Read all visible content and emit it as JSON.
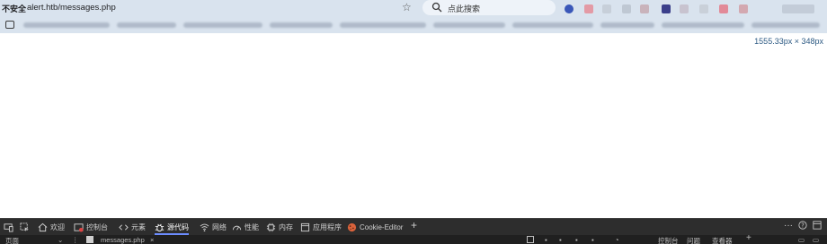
{
  "address_bar": {
    "insecure_label": "不安全",
    "url": "alert.htb/messages.php",
    "search_placeholder": "点此搜索"
  },
  "viewport_dims": "1555.33px × 348px",
  "devtools": {
    "tabs": [
      {
        "label": "欢迎"
      },
      {
        "label": "控制台"
      },
      {
        "label": "元素"
      },
      {
        "label": "源代码"
      },
      {
        "label": "网络"
      },
      {
        "label": "性能"
      },
      {
        "label": "内存"
      },
      {
        "label": "应用程序"
      },
      {
        "label": "Cookie-Editor"
      }
    ],
    "active_tab": "源代码",
    "add_tab": "+",
    "more": "···",
    "row2": {
      "left_label": "页面",
      "file_tab": "messages.php",
      "close": "×",
      "right_tabs": [
        "控制台",
        "问题",
        "查看器"
      ]
    }
  },
  "colors": {
    "chrome_bg": "#d9e3ee",
    "devtools_bg": "#2d2d2d",
    "active_accent": "#6c8cff",
    "dims_text": "#2e5b84"
  }
}
